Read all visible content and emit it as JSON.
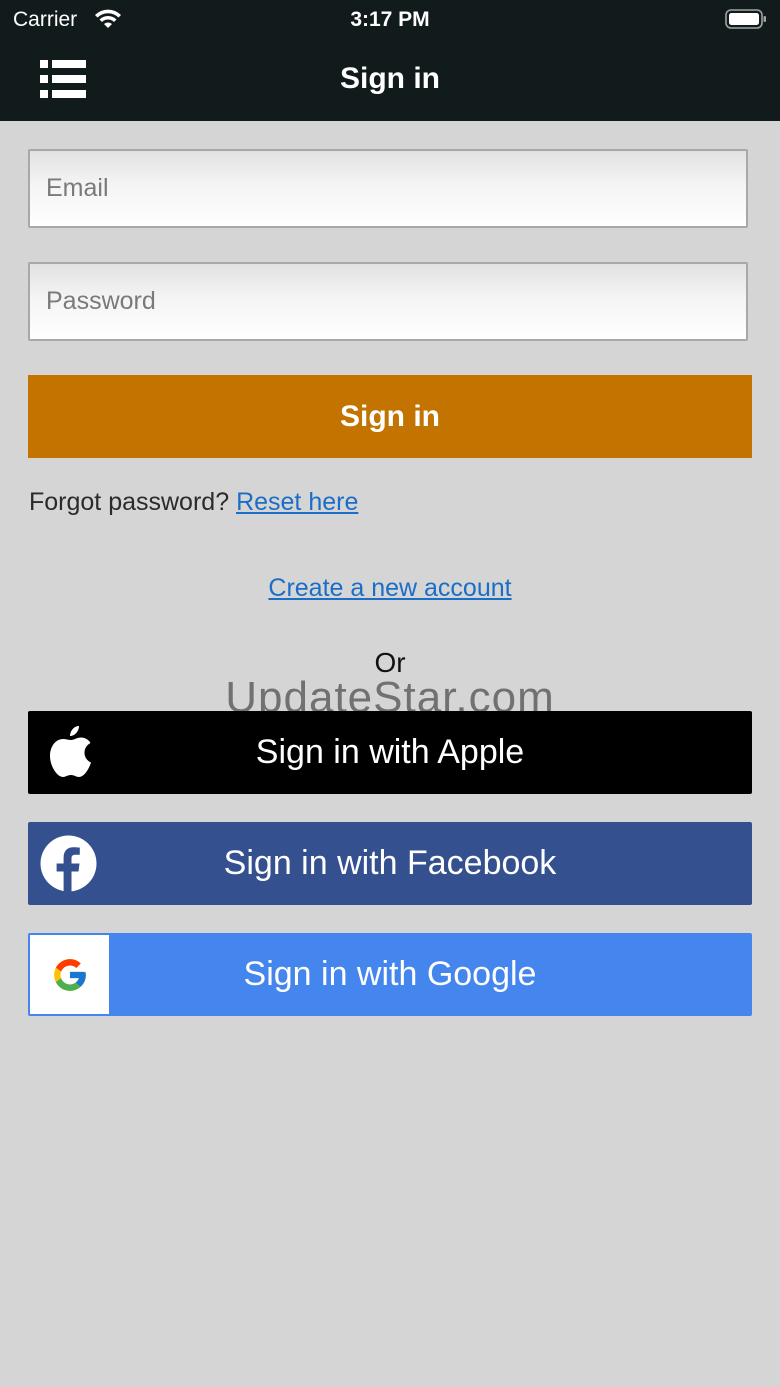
{
  "status_bar": {
    "carrier": "Carrier",
    "time": "3:17 PM"
  },
  "nav": {
    "title": "Sign in",
    "menu_icon": "list-menu-icon"
  },
  "form": {
    "email_placeholder": "Email",
    "password_placeholder": "Password",
    "signin_label": "Sign in"
  },
  "forgot": {
    "prefix": "Forgot password?",
    "link": "Reset here"
  },
  "create_account": "Create a new account",
  "or_text": "Or",
  "watermark": "UpdateStar.com",
  "social": {
    "apple": "Sign in with Apple",
    "facebook": "Sign in with Facebook",
    "google": "Sign in with Google"
  },
  "colors": {
    "nav_bg": "#111b1c",
    "page_bg": "#d5d5d5",
    "signin_button": "#c27300",
    "link": "#1a6ec8",
    "apple": "#000000",
    "facebook": "#34508f",
    "google": "#4586ee"
  }
}
